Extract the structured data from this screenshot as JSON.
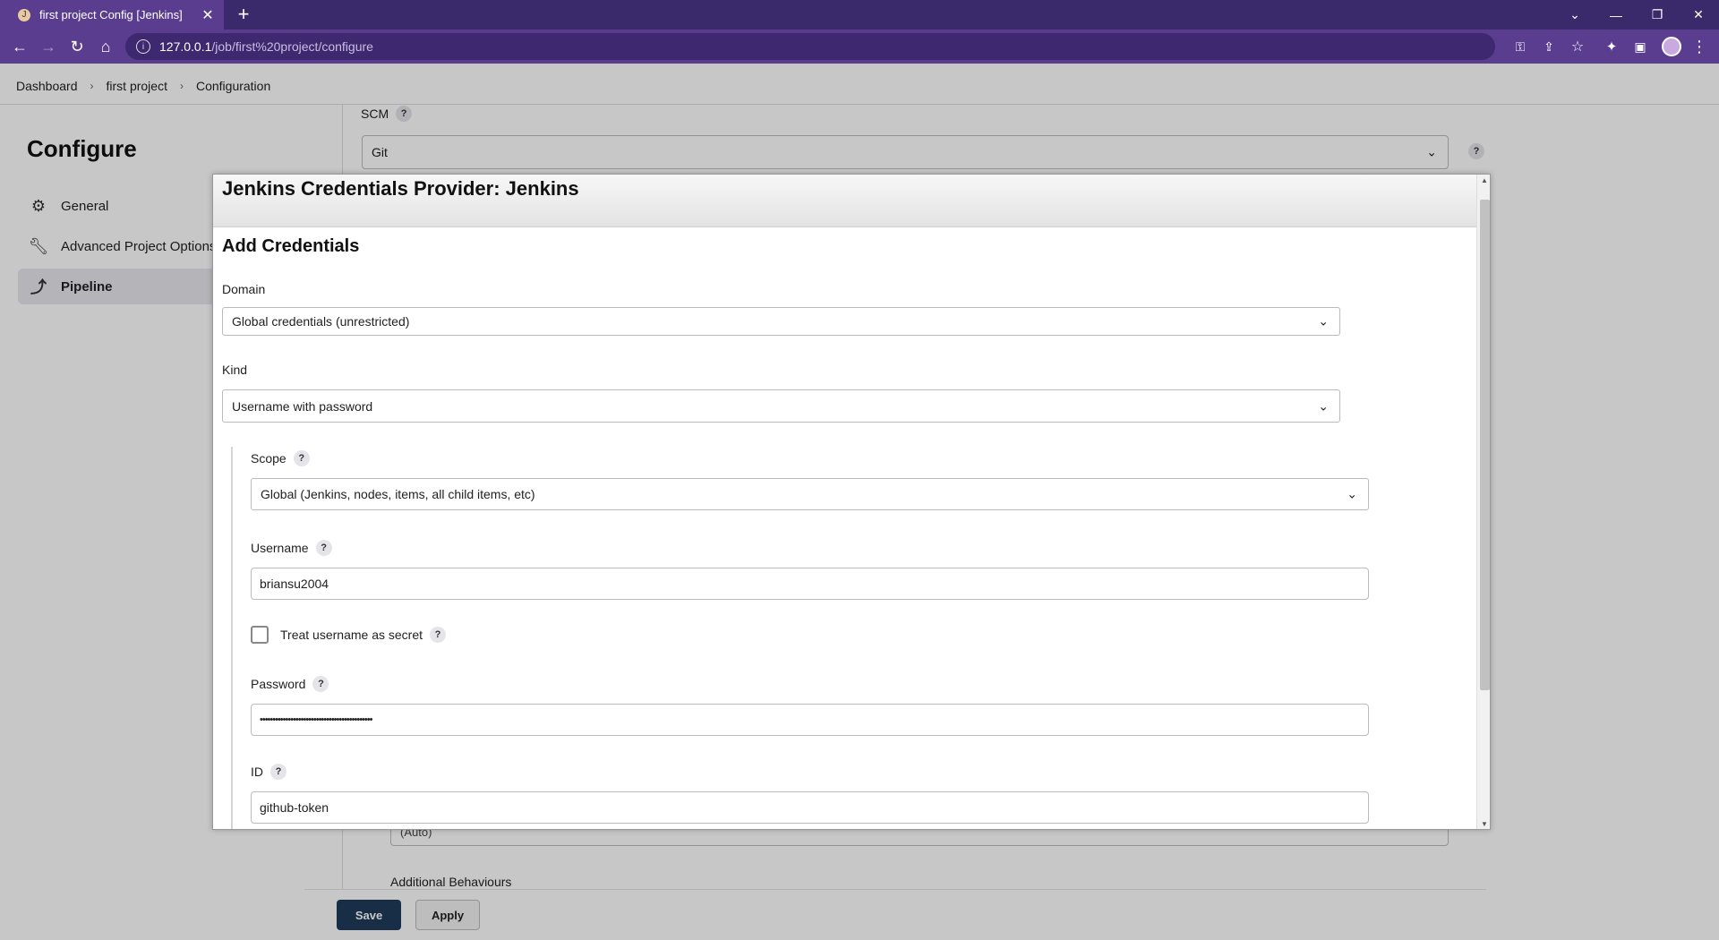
{
  "browser": {
    "tab_title": "first project Config [Jenkins]",
    "url_host": "127.0.0.1",
    "url_path": "/job/first%20project/configure"
  },
  "breadcrumb": [
    "Dashboard",
    "first project",
    "Configuration"
  ],
  "sidebar": {
    "title": "Configure",
    "items": [
      {
        "label": "General",
        "icon": "gear-icon"
      },
      {
        "label": "Advanced Project Options",
        "icon": "wrench-icon"
      },
      {
        "label": "Pipeline",
        "icon": "pipeline-icon"
      }
    ]
  },
  "scm": {
    "label": "SCM",
    "selected": "Git",
    "hidden_select_value": "(Auto)",
    "additional_behaviours": "Additional Behaviours"
  },
  "buttons": {
    "save": "Save",
    "apply": "Apply"
  },
  "modal": {
    "title": "Jenkins Credentials Provider: Jenkins",
    "heading": "Add Credentials",
    "domain_label": "Domain",
    "domain_value": "Global credentials (unrestricted)",
    "kind_label": "Kind",
    "kind_value": "Username with password",
    "scope_label": "Scope",
    "scope_value": "Global (Jenkins, nodes, items, all child items, etc)",
    "username_label": "Username",
    "username_value": "briansu2004",
    "treat_secret_label": "Treat username as secret",
    "password_label": "Password",
    "password_value": "••••••••••••••••••••••••••••••••••••••••••••",
    "id_label": "ID",
    "id_value": "github-token"
  },
  "help_glyph": "?"
}
